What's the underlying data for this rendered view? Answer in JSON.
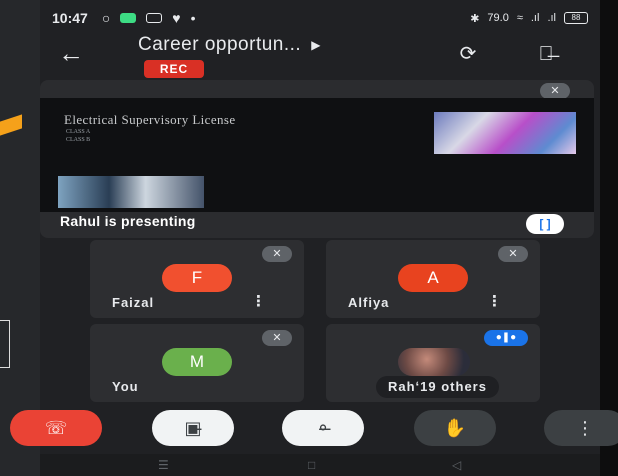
{
  "status_bar": {
    "time": "10:47",
    "speed": "79.0",
    "battery": "88"
  },
  "call": {
    "title": "Career opportun...",
    "rec_badge": "REC"
  },
  "presentation": {
    "slide_title": "Electrical Supervisory License",
    "bullets": [
      "CLASS A",
      "CLASS B"
    ],
    "presenter_label": "Rahul is presenting"
  },
  "participants": [
    {
      "initial": "F",
      "name": "Faizal",
      "color": "#f1502f"
    },
    {
      "initial": "A",
      "name": "Alfiya",
      "color": "#e8431f"
    },
    {
      "initial": "M",
      "name": "You",
      "color": "#6ab04c"
    },
    {
      "name": "Rahul",
      "others_label": "Rahʻ19 others"
    }
  ],
  "colors": {
    "end_call": "#ea4335",
    "rec": "#d93025",
    "speaking": "#1a73e8"
  }
}
